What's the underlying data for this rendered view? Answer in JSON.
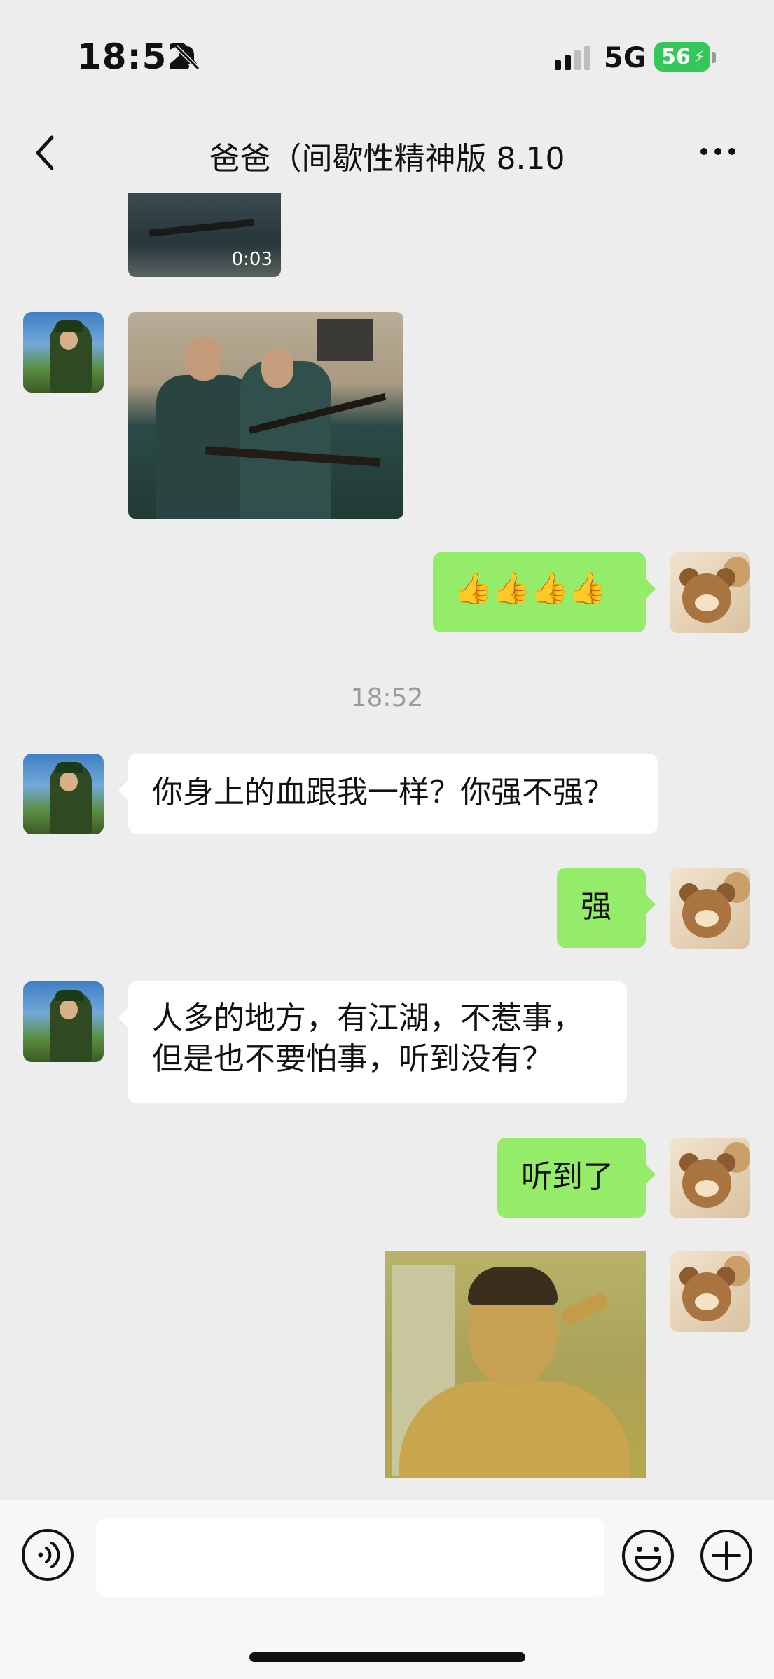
{
  "status_bar": {
    "time": "18:52",
    "network": "5G",
    "battery": "56",
    "icons": [
      "bell-slash-icon",
      "signal-icon",
      "battery-charging-icon"
    ]
  },
  "nav": {
    "title": "爸爸（间歇性精神版 8.10",
    "icons": [
      "back-chevron-icon",
      "more-dots-icon"
    ]
  },
  "messages": [
    {
      "side": "left",
      "type": "video",
      "duration": "0:03"
    },
    {
      "side": "left",
      "type": "image"
    },
    {
      "side": "right",
      "type": "text",
      "text": "👍👍👍👍"
    },
    {
      "type": "timestamp",
      "text": "18:52"
    },
    {
      "side": "left",
      "type": "text",
      "text": "你身上的血跟我一样？你强不强？"
    },
    {
      "side": "right",
      "type": "text",
      "text": "强"
    },
    {
      "side": "left",
      "type": "text",
      "lines": [
        "人多的地方，有江湖，不惹事，",
        "但是也不要怕事，听到没有？"
      ]
    },
    {
      "side": "right",
      "type": "text",
      "text": "听到了"
    },
    {
      "side": "right",
      "type": "image"
    }
  ],
  "input_bar": {
    "value": "",
    "icons": [
      "voice-icon",
      "emoji-icon",
      "plus-icon"
    ]
  },
  "colors": {
    "background": "#ededed",
    "bubble_right": "#95ec69",
    "bubble_left": "#ffffff",
    "battery": "#34c759"
  }
}
